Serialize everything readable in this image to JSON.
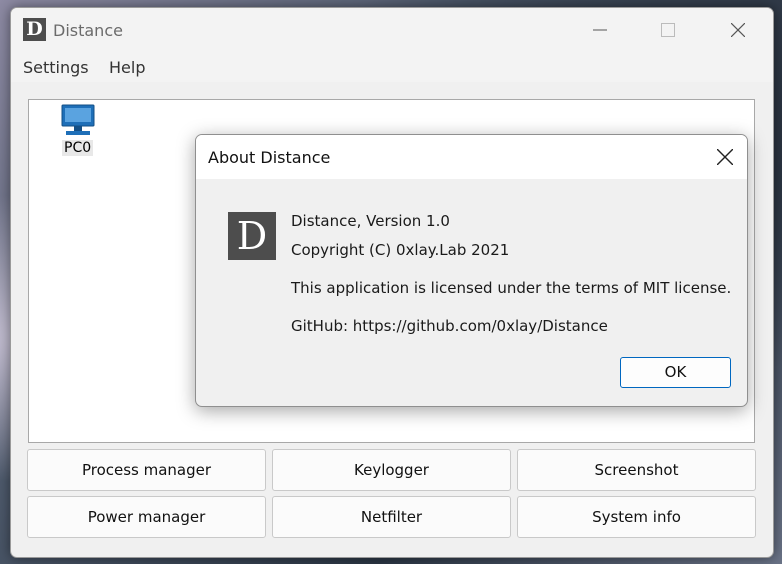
{
  "window": {
    "title": "Distance",
    "app_icon_letter": "D",
    "icons": {
      "minimize": "minimize-icon",
      "maximize": "maximize-icon",
      "close": "close-icon"
    }
  },
  "menu": {
    "items": [
      "Settings",
      "Help"
    ]
  },
  "clients": [
    {
      "label": "PC0",
      "icon": "computer-icon"
    }
  ],
  "actions": {
    "row1": [
      "Process manager",
      "Keylogger",
      "Screenshot"
    ],
    "row2": [
      "Power manager",
      "Netfilter",
      "System info"
    ]
  },
  "about_dialog": {
    "title": "About Distance",
    "logo_letter": "D",
    "version": "Distance, Version 1.0",
    "copyright": "Copyright (C) 0xlay.Lab 2021",
    "license": "This application is licensed under the terms of MIT license.",
    "github": "GitHub: https://github.com/0xlay/Distance",
    "ok_label": "OK"
  },
  "colors": {
    "accent": "#0067c0",
    "logo_bg": "#4d4d4d",
    "pc_icon": "#1e6fb8"
  }
}
